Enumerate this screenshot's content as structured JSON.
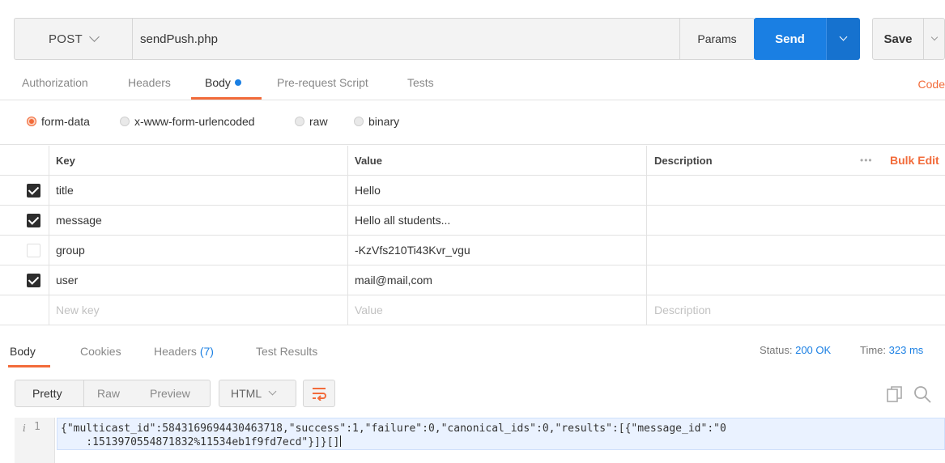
{
  "request": {
    "method": "POST",
    "url": "sendPush.php",
    "params_label": "Params",
    "send_label": "Send",
    "save_label": "Save"
  },
  "request_tabs": [
    {
      "label": "Authorization"
    },
    {
      "label": "Headers"
    },
    {
      "label": "Body"
    },
    {
      "label": "Pre-request Script"
    },
    {
      "label": "Tests"
    }
  ],
  "code_label": "Code",
  "body_types": [
    {
      "label": "form-data",
      "checked": true
    },
    {
      "label": "x-www-form-urlencoded",
      "checked": false
    },
    {
      "label": "raw",
      "checked": false
    },
    {
      "label": "binary",
      "checked": false
    }
  ],
  "table": {
    "headers": {
      "key": "Key",
      "value": "Value",
      "description": "Description"
    },
    "more_label": "•••",
    "bulk_edit_label": "Bulk Edit",
    "rows": [
      {
        "key": "title",
        "value": "Hello",
        "description": "",
        "enabled": true
      },
      {
        "key": "message",
        "value": "Hello all students...",
        "description": "",
        "enabled": true
      },
      {
        "key": "group",
        "value": "-KzVfs210Ti43Kvr_vgu",
        "description": "",
        "enabled": false
      },
      {
        "key": "user",
        "value": "mail@mail,com",
        "description": "",
        "enabled": true
      }
    ],
    "placeholders": {
      "key": "New key",
      "value": "Value",
      "description": "Description"
    }
  },
  "response_tabs": [
    {
      "label": "Body"
    },
    {
      "label": "Cookies"
    },
    {
      "label": "Headers",
      "count": "(7)"
    },
    {
      "label": "Test Results"
    }
  ],
  "status": {
    "label": "Status:",
    "value": "200 OK"
  },
  "time": {
    "label": "Time:",
    "value": "323 ms"
  },
  "view_options": [
    "Pretty",
    "Raw",
    "Preview"
  ],
  "language": "HTML",
  "response": {
    "line_number": "1",
    "info_glyph": "i",
    "line1": "{\"multicast_id\":5843169694430463718,\"success\":1,\"failure\":0,\"canonical_ids\":0,\"results\":[{\"message_id\":\"0",
    "line2": "    :1513970554871832%11534eb1f9fd7ecd\"}]}[]"
  },
  "colors": {
    "accent": "#f26b3a",
    "primary": "#1a7fe3",
    "surface": "#f3f3f3"
  }
}
